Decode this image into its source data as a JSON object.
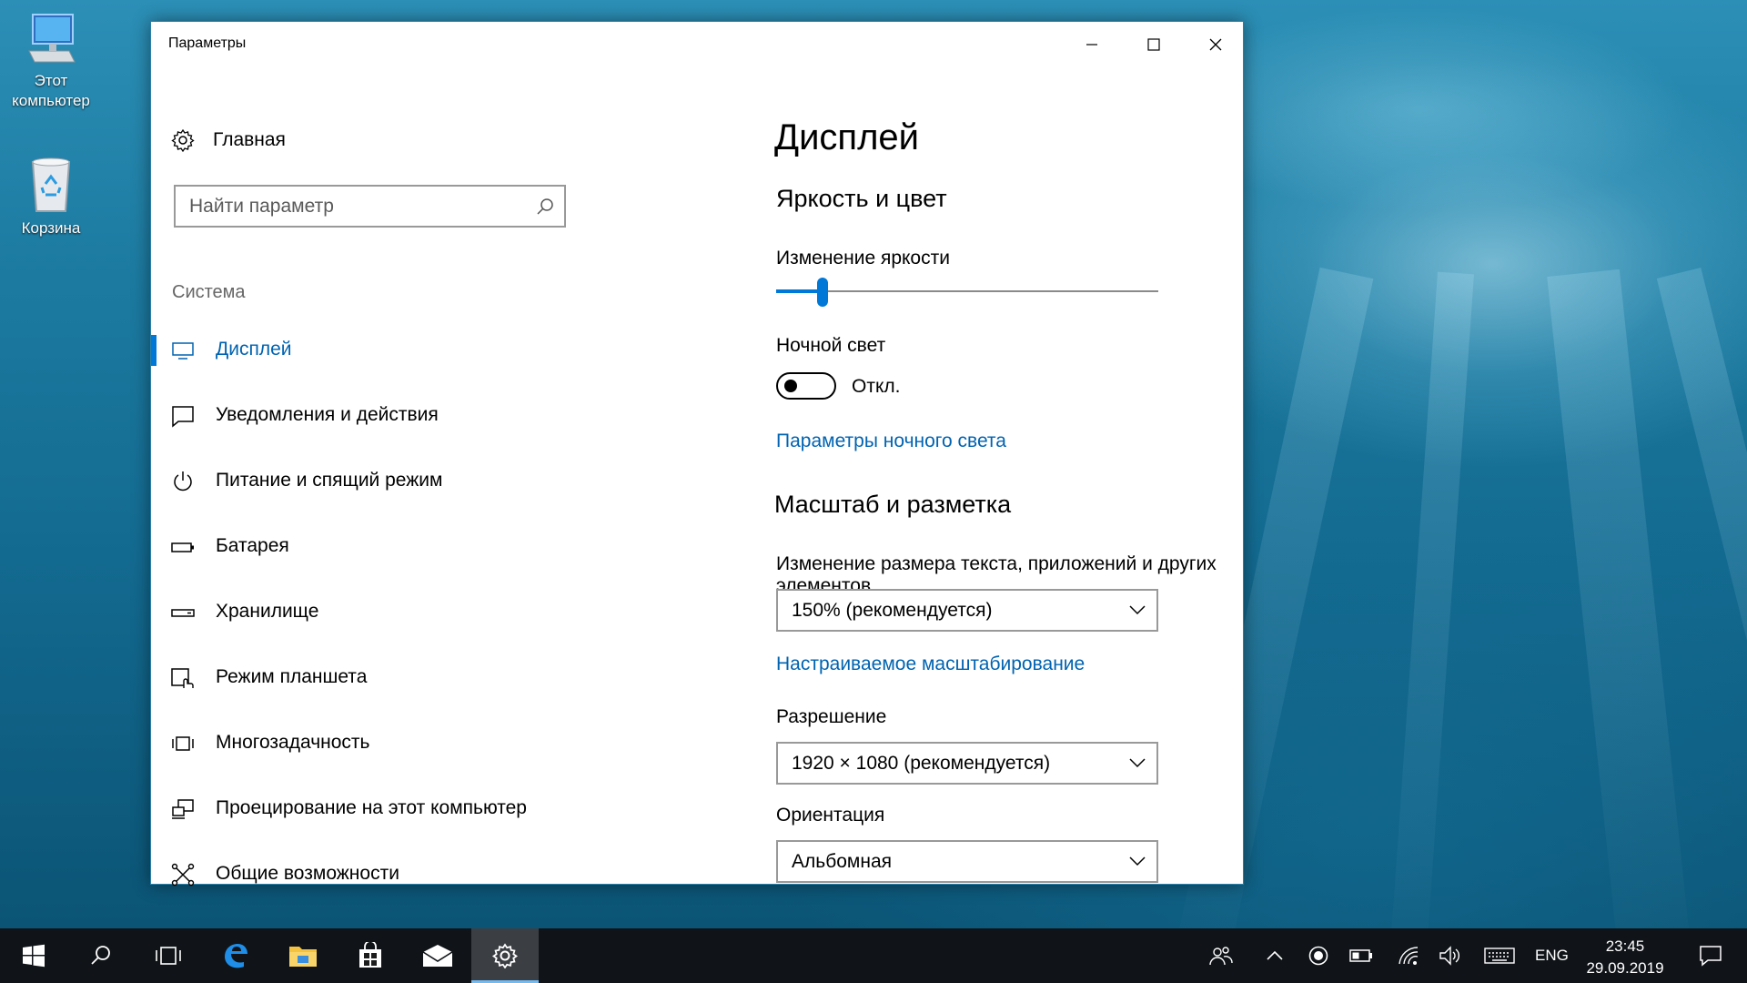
{
  "desktop": {
    "icons": [
      {
        "label_line1": "Этот",
        "label_line2": "компьютер",
        "icon": "computer-icon"
      },
      {
        "label_line1": "Корзина",
        "label_line2": "",
        "icon": "recycle-bin-icon"
      }
    ]
  },
  "window": {
    "title": "Параметры",
    "controls": {
      "minimize": "minimize-icon",
      "maximize": "maximize-icon",
      "close": "close-icon"
    }
  },
  "sidebar": {
    "home_label": "Главная",
    "search_placeholder": "Найти параметр",
    "group_label": "Система",
    "items": [
      {
        "label": "Дисплей",
        "icon": "monitor-icon",
        "active": true
      },
      {
        "label": "Уведомления и действия",
        "icon": "notification-icon",
        "active": false
      },
      {
        "label": "Питание и спящий режим",
        "icon": "power-icon",
        "active": false
      },
      {
        "label": "Батарея",
        "icon": "battery-icon",
        "active": false
      },
      {
        "label": "Хранилище",
        "icon": "storage-icon",
        "active": false
      },
      {
        "label": "Режим планшета",
        "icon": "tablet-mode-icon",
        "active": false
      },
      {
        "label": "Многозадачность",
        "icon": "multitasking-icon",
        "active": false
      },
      {
        "label": "Проецирование на этот компьютер",
        "icon": "projecting-icon",
        "active": false
      },
      {
        "label": "Общие возможности",
        "icon": "shared-experiences-icon",
        "active": false
      }
    ]
  },
  "content": {
    "page_title": "Дисплей",
    "brightness_section": "Яркость и цвет",
    "brightness_label": "Изменение яркости",
    "brightness_value": 0.11,
    "night_light_label": "Ночной свет",
    "night_light_state": "Откл.",
    "night_light_on": false,
    "night_light_link": "Параметры ночного света",
    "scale_section": "Масштаб и разметка",
    "scale_label": "Изменение размера текста, приложений и других элементов",
    "scale_value": "150% (рекомендуется)",
    "custom_scale_link": "Настраиваемое масштабирование",
    "resolution_label": "Разрешение",
    "resolution_value": "1920 × 1080 (рекомендуется)",
    "orientation_label": "Ориентация",
    "orientation_value": "Альбомная"
  },
  "taskbar": {
    "apps": [
      "start-icon",
      "search-icon",
      "task-view-icon",
      "edge-icon",
      "file-explorer-icon",
      "store-icon",
      "mail-icon",
      "settings-icon"
    ],
    "active_app": "settings-icon",
    "tray": [
      "people-icon",
      "chevron-up-icon",
      "record-icon",
      "battery-icon",
      "wifi-icon",
      "volume-icon",
      "keyboard-icon"
    ],
    "language": "ENG",
    "time": "23:45",
    "date": "29.09.2019",
    "notifications": "action-center-icon"
  },
  "colors": {
    "accent": "#0078d7",
    "link": "#0063b1",
    "taskbar": "#101418"
  }
}
